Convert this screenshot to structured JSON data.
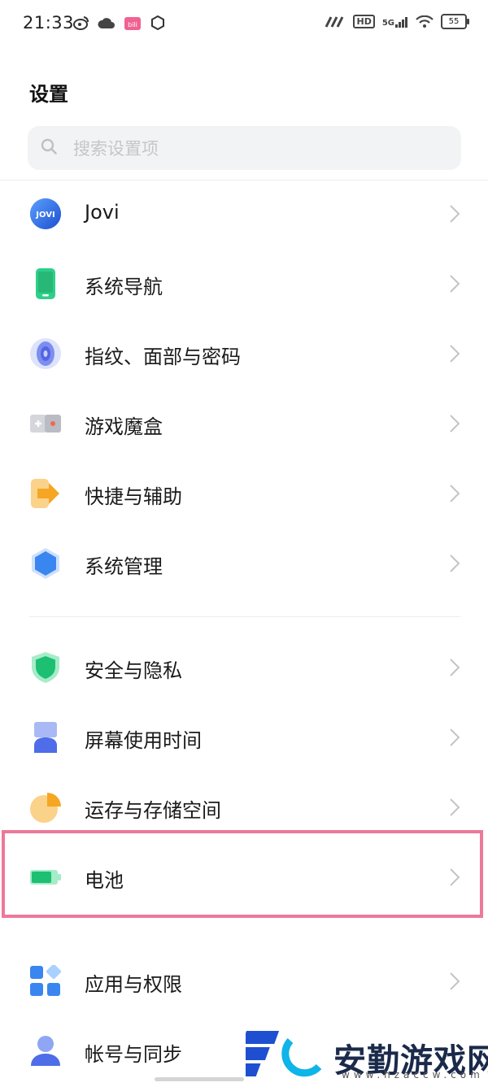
{
  "status_bar": {
    "time": "21:33",
    "network": "5G",
    "hd": "HD",
    "battery": "55",
    "icons": [
      "weibo-icon",
      "cloud-icon",
      "bilibili-icon",
      "hexagon-icon",
      "signal-icon",
      "hd-icon",
      "5g-signal-icon",
      "wifi-icon",
      "battery-icon"
    ]
  },
  "page": {
    "title": "设置"
  },
  "search": {
    "placeholder": "搜索设置项"
  },
  "settings": {
    "group1": [
      {
        "label": "Jovi",
        "icon": "jovi-icon"
      },
      {
        "label": "系统导航",
        "icon": "phone-navigation-icon"
      },
      {
        "label": "指纹、面部与密码",
        "icon": "fingerprint-icon"
      },
      {
        "label": "游戏魔盒",
        "icon": "gamepad-icon"
      },
      {
        "label": "快捷与辅助",
        "icon": "arrow-shortcut-icon"
      },
      {
        "label": "系统管理",
        "icon": "hexagon-system-icon"
      }
    ],
    "group2": [
      {
        "label": "安全与隐私",
        "icon": "shield-icon"
      },
      {
        "label": "屏幕使用时间",
        "icon": "hourglass-icon"
      },
      {
        "label": "运存与存储空间",
        "icon": "storage-pie-icon"
      },
      {
        "label": "电池",
        "icon": "battery-icon",
        "highlighted": true
      }
    ],
    "group3": [
      {
        "label": "应用与权限",
        "icon": "apps-grid-icon"
      },
      {
        "label": "帐号与同步",
        "icon": "account-icon"
      }
    ]
  },
  "jovi_badge": "JOVI",
  "watermark": {
    "text": "安勤游戏网",
    "url": "www.hzaccw.com"
  },
  "colors": {
    "highlight_border": "#ee7898",
    "chevron": "#c4c4c4",
    "jovi_blue": "#2f6ee8",
    "green": "#2ecf8a",
    "orange": "#f5a623",
    "blue": "#3a86f0"
  }
}
